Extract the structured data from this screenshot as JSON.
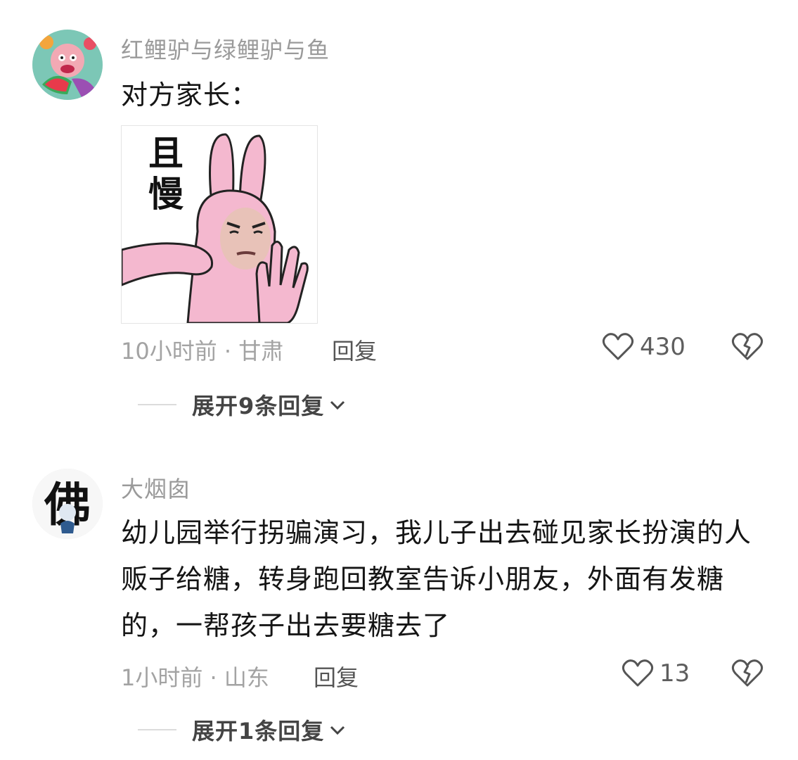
{
  "comments": [
    {
      "username": "红鲤驴与绿鲤驴与鱼",
      "text": "对方家长：",
      "sticker_text": "且慢",
      "time": "10小时前",
      "location": "甘肃",
      "reply_label": "回复",
      "likes": "430",
      "expand_label": "展开9条回复"
    },
    {
      "username": "大烟囱",
      "text": "幼儿园举行拐骗演习，我儿子出去碰见家长扮演的人贩子给糖，转身跑回教室告诉小朋友，外面有发糖的，一帮孩子出去要糖去了",
      "avatar_text": "佛",
      "time": "1小时前",
      "location": "山东",
      "reply_label": "回复",
      "likes": "13",
      "expand_label": "展开1条回复"
    }
  ],
  "icons": {
    "like": "heart-outline-icon",
    "dislike": "broken-heart-icon",
    "expand": "chevron-down-icon"
  },
  "colors": {
    "username": "#9a9a9a",
    "meta": "#a3a3a3",
    "sticker_pink": "#f4b8cf"
  }
}
